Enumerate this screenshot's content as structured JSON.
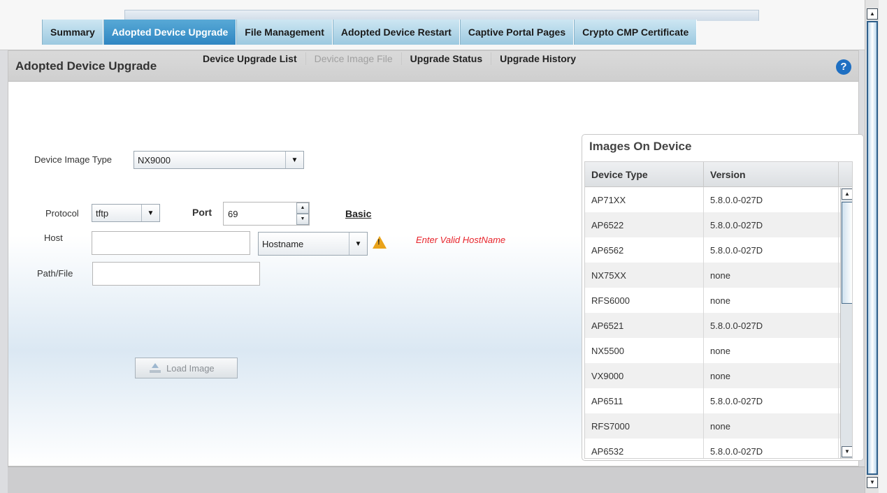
{
  "tabs": [
    {
      "label": "Summary",
      "active": false
    },
    {
      "label": "Adopted Device Upgrade",
      "active": true
    },
    {
      "label": "File Management",
      "active": false
    },
    {
      "label": "Adopted Device Restart",
      "active": false
    },
    {
      "label": "Captive Portal Pages",
      "active": false
    },
    {
      "label": "Crypto CMP Certificate",
      "active": false
    }
  ],
  "panel": {
    "title": "Adopted Device Upgrade",
    "help_icon": "question-circle-icon"
  },
  "subnav": {
    "device_upgrade_list": "Device Upgrade List",
    "device_image_file": "Device Image File",
    "upgrade_status": "Upgrade Status",
    "upgrade_history": "Upgrade History"
  },
  "form": {
    "device_image_type_label": "Device Image Type",
    "device_image_type_value": "NX9000",
    "protocol_label": "Protocol",
    "protocol_value": "tftp",
    "port_label": "Port",
    "port_value": "69",
    "basic_link": "Basic",
    "host_label": "Host",
    "host_value": "",
    "host_type_value": "Hostname",
    "host_error": "Enter Valid HostName",
    "path_label": "Path/File",
    "path_value": "",
    "load_button": "Load Image"
  },
  "images_on_device": {
    "title": "Images On Device",
    "columns": [
      "Device Type",
      "Version"
    ],
    "rows": [
      [
        "AP71XX",
        "5.8.0.0-027D"
      ],
      [
        "AP6522",
        "5.8.0.0-027D"
      ],
      [
        "AP6562",
        "5.8.0.0-027D"
      ],
      [
        "NX75XX",
        "none"
      ],
      [
        "RFS6000",
        "none"
      ],
      [
        "AP6521",
        "5.8.0.0-027D"
      ],
      [
        "NX5500",
        "none"
      ],
      [
        "VX9000",
        "none"
      ],
      [
        "AP6511",
        "5.8.0.0-027D"
      ],
      [
        "RFS7000",
        "none"
      ],
      [
        "AP6532",
        "5.8.0.0-027D"
      ]
    ]
  },
  "colors": {
    "accent": "#2f86c2",
    "error": "#e8232a",
    "warning": "#e9a31a"
  }
}
